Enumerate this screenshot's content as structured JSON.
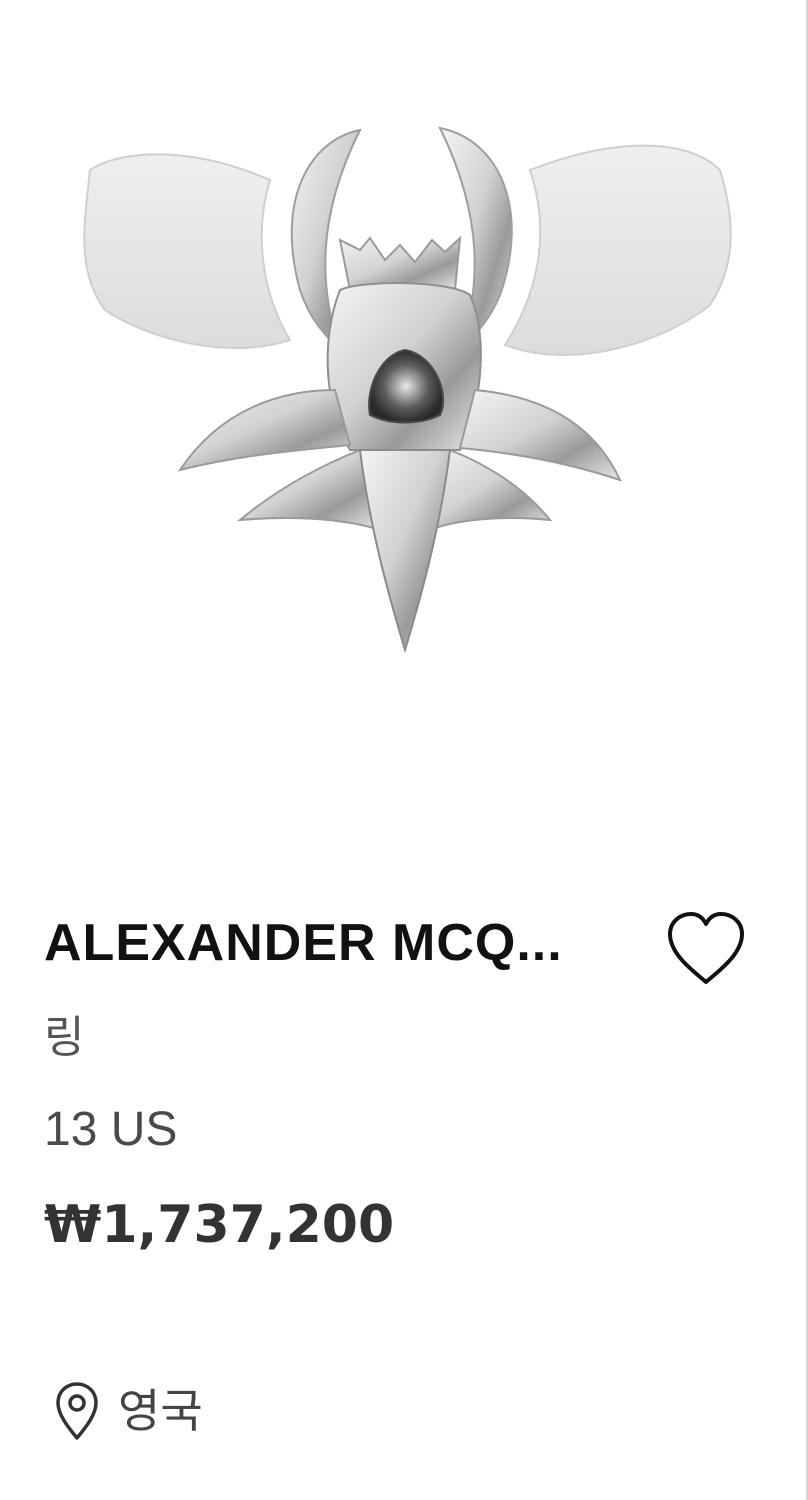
{
  "product": {
    "brand": "ALEXANDER MCQ...",
    "category": "링",
    "size": "13 US",
    "price": "₩1,737,200",
    "location": "영국",
    "wishlist_icon": "heart-outline-icon",
    "location_icon": "map-pin-icon"
  },
  "colors": {
    "text_primary": "#111111",
    "text_secondary": "#555555",
    "background": "#ffffff"
  }
}
